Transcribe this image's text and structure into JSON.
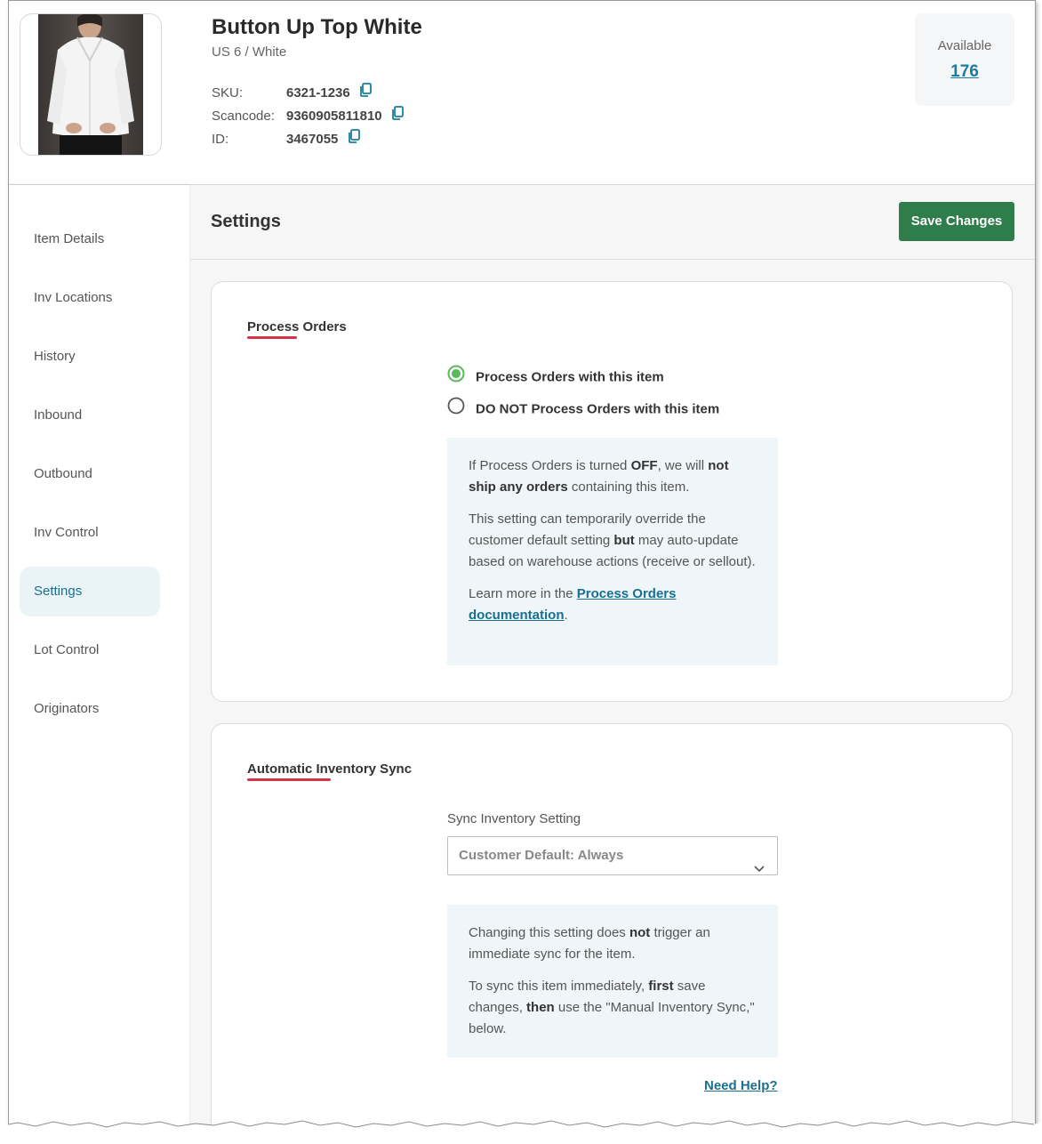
{
  "product": {
    "title": "Button Up Top White",
    "variant": "US 6 / White",
    "sku_label": "SKU:",
    "sku": "6321-1236",
    "scancode_label": "Scancode:",
    "scancode": "9360905811810",
    "id_label": "ID:",
    "id": "3467055"
  },
  "available": {
    "label": "Available",
    "value": "176"
  },
  "sidebar": {
    "items": [
      {
        "label": "Item Details"
      },
      {
        "label": "Inv Locations"
      },
      {
        "label": "History"
      },
      {
        "label": "Inbound"
      },
      {
        "label": "Outbound"
      },
      {
        "label": "Inv Control"
      },
      {
        "label": "Settings",
        "active": true
      },
      {
        "label": "Lot Control"
      },
      {
        "label": "Originators"
      }
    ]
  },
  "main": {
    "title": "Settings",
    "save_label": "Save Changes"
  },
  "process_orders": {
    "title": "Process Orders",
    "option_on": "Process Orders with this item",
    "option_off": "DO NOT Process Orders with this item",
    "selected": "on",
    "info": {
      "p1_a": "If Process Orders is turned ",
      "p1_b": "OFF",
      "p1_c": ", we will ",
      "p1_d": "not ship any orders",
      "p1_e": " containing this item.",
      "p2_a": "This setting can temporarily override the customer default setting ",
      "p2_b": "but",
      "p2_c": " may auto-update based on warehouse actions (receive or sellout).",
      "p3_a": "Learn more in the ",
      "p3_link": "Process Orders documentation",
      "p3_c": "."
    }
  },
  "inventory_sync": {
    "title": "Automatic Inventory Sync",
    "field_label": "Sync Inventory Setting",
    "select_value": "Customer Default: Always",
    "info": {
      "p1_a": "Changing this setting does ",
      "p1_b": "not",
      "p1_c": " trigger an immediate sync for the item.",
      "p2_a": "To sync this item immediately, ",
      "p2_b": "first",
      "p2_c": " save changes, ",
      "p2_d": "then",
      "p2_e": " use the \"Manual Inventory Sync,\" below."
    },
    "help_link": "Need Help?"
  },
  "colors": {
    "accent_green": "#2e7d4a",
    "link_blue": "#1a6e8e",
    "underline_red": "#d6334a",
    "info_bg": "#eef6f9",
    "radio_green": "#5cb85c"
  }
}
